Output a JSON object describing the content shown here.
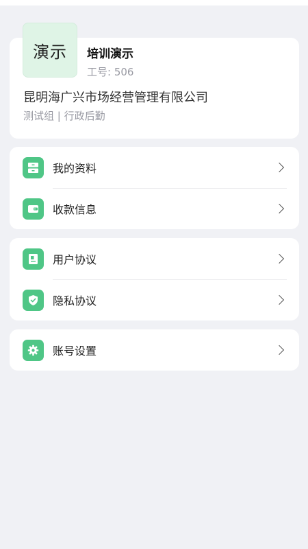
{
  "profile": {
    "avatar_text": "演示",
    "name": "培训演示",
    "employee_id": "工号: 506",
    "company": "昆明海广兴市场经营管理有限公司",
    "department": "测试组 | 行政后勤"
  },
  "menu": {
    "my_profile": "我的资料",
    "payment_info": "收款信息",
    "user_agreement": "用户协议",
    "privacy_agreement": "隐私协议",
    "account_settings": "账号设置"
  },
  "icons": {
    "my_profile": "drawer-icon",
    "payment_info": "wallet-icon",
    "user_agreement": "document-icon",
    "privacy_agreement": "shield-icon",
    "account_settings": "gear-icon",
    "chevron": "chevron-right-icon"
  },
  "colors": {
    "accent": "#4fc686",
    "avatar_bg": "#dff4e6",
    "page_bg": "#f0f1f5"
  }
}
